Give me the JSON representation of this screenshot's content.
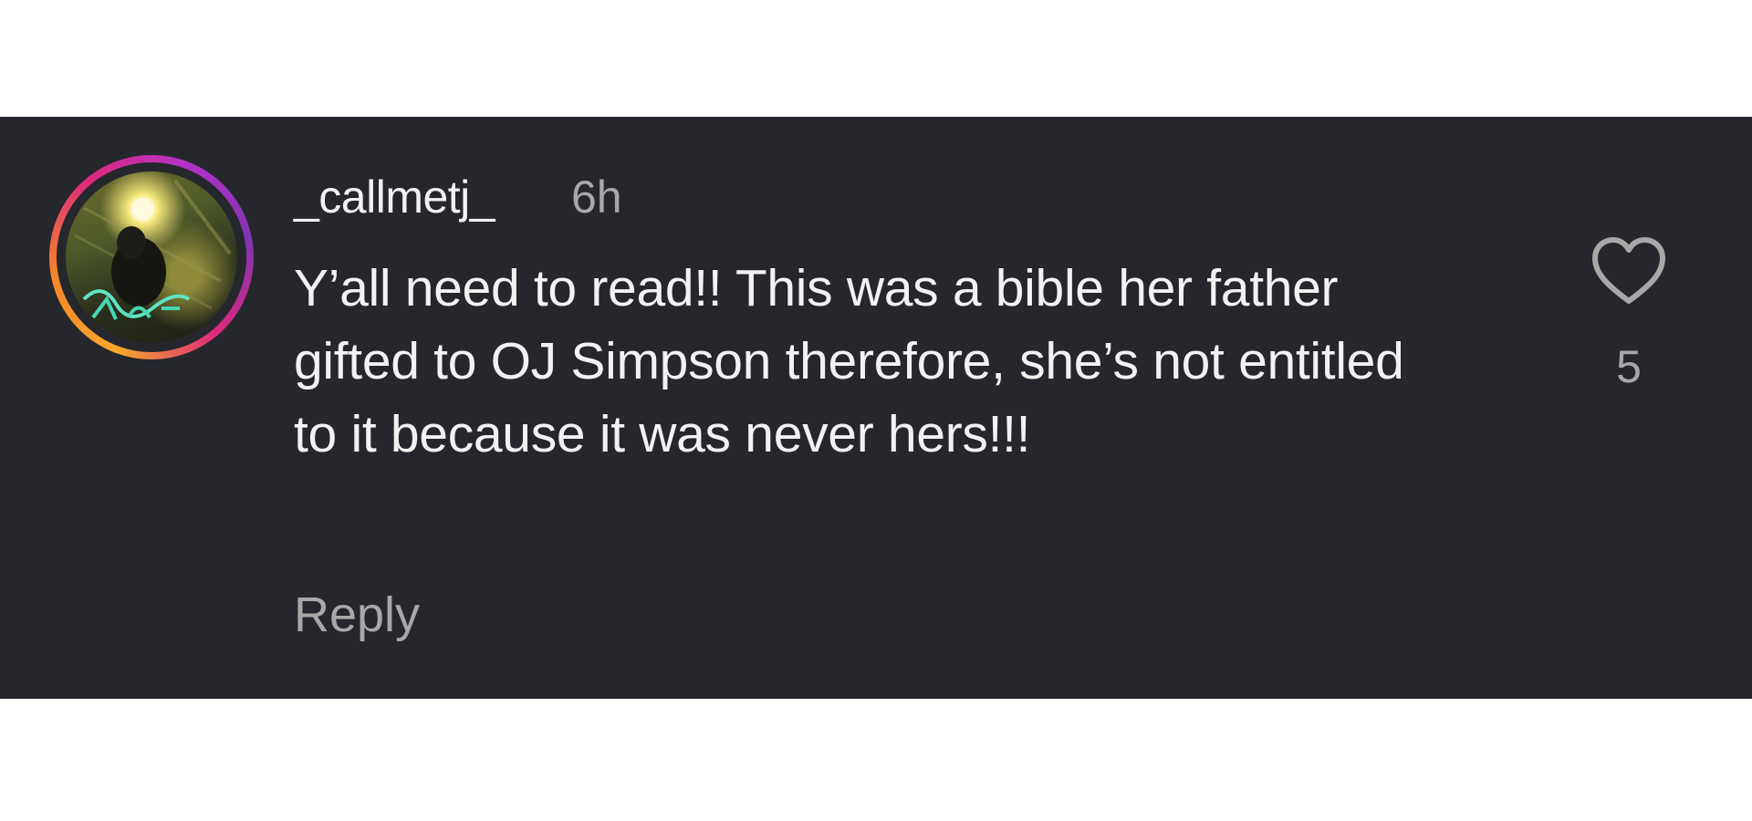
{
  "comment": {
    "username": "_callmetj_",
    "timestamp": "6h",
    "text": "Y’all need to read!! This was a bible her father gifted to OJ Simpson therefore, she’s not entitled to it because it was never hers!!!",
    "reply_label": "Reply",
    "like_count": "5",
    "like_icon": "heart-outline-icon"
  },
  "colors": {
    "card_background": "#25272c",
    "primary_text": "#f2f2f2",
    "secondary_text": "#a8a8a8",
    "page_background": "#ffffff"
  }
}
